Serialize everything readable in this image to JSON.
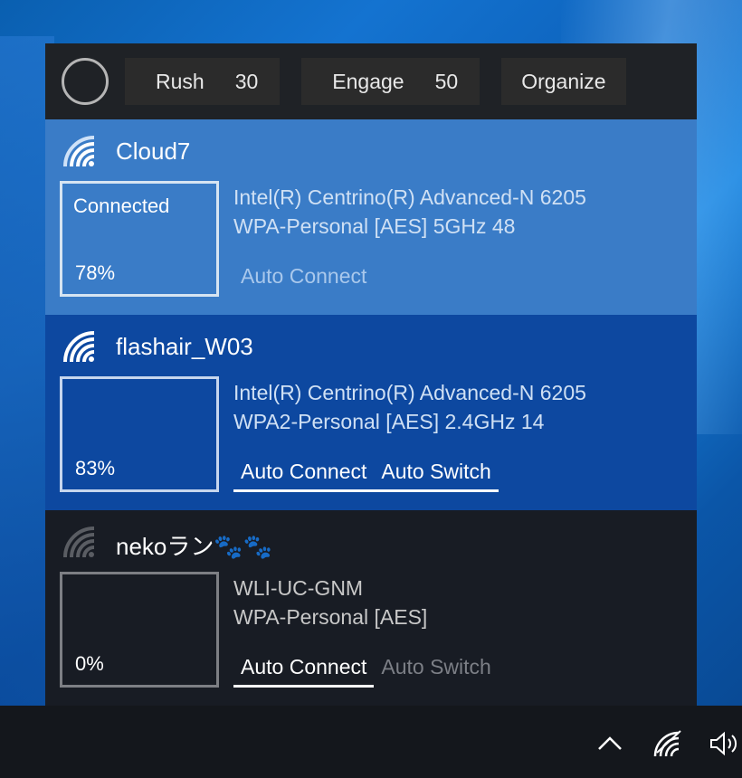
{
  "toolbar": {
    "rush_label": "Rush",
    "rush_value": "30",
    "engage_label": "Engage",
    "engage_value": "50",
    "organize_label": "Organize"
  },
  "networks": [
    {
      "ssid": "Cloud7",
      "status": "Connected",
      "signal": "78%",
      "adapter": "Intel(R) Centrino(R) Advanced-N 6205",
      "security": "WPA-Personal [AES] 5GHz 48",
      "toggles": [
        "Auto Connect"
      ]
    },
    {
      "ssid": "flashair_W03",
      "status": "",
      "signal": "83%",
      "adapter": "Intel(R) Centrino(R) Advanced-N 6205",
      "security": "WPA2-Personal [AES] 2.4GHz 14",
      "toggles": [
        "Auto Connect",
        "Auto Switch"
      ]
    },
    {
      "ssid": "nekoラン🐾🐾",
      "status": "",
      "signal": "0%",
      "adapter": "WLI-UC-GNM",
      "security": "WPA-Personal [AES]",
      "toggles": [
        "Auto Connect",
        "Auto Switch"
      ]
    }
  ],
  "taskbar": {
    "icons": [
      "chevron-up-icon",
      "wifi-icon",
      "speaker-icon"
    ]
  },
  "colors": {
    "net_connected_bg": "#3a7cc7",
    "net_selected_bg": "#0d48a0",
    "net_idle_bg": "#181c24",
    "toolbar_bg": "#1f2226"
  }
}
